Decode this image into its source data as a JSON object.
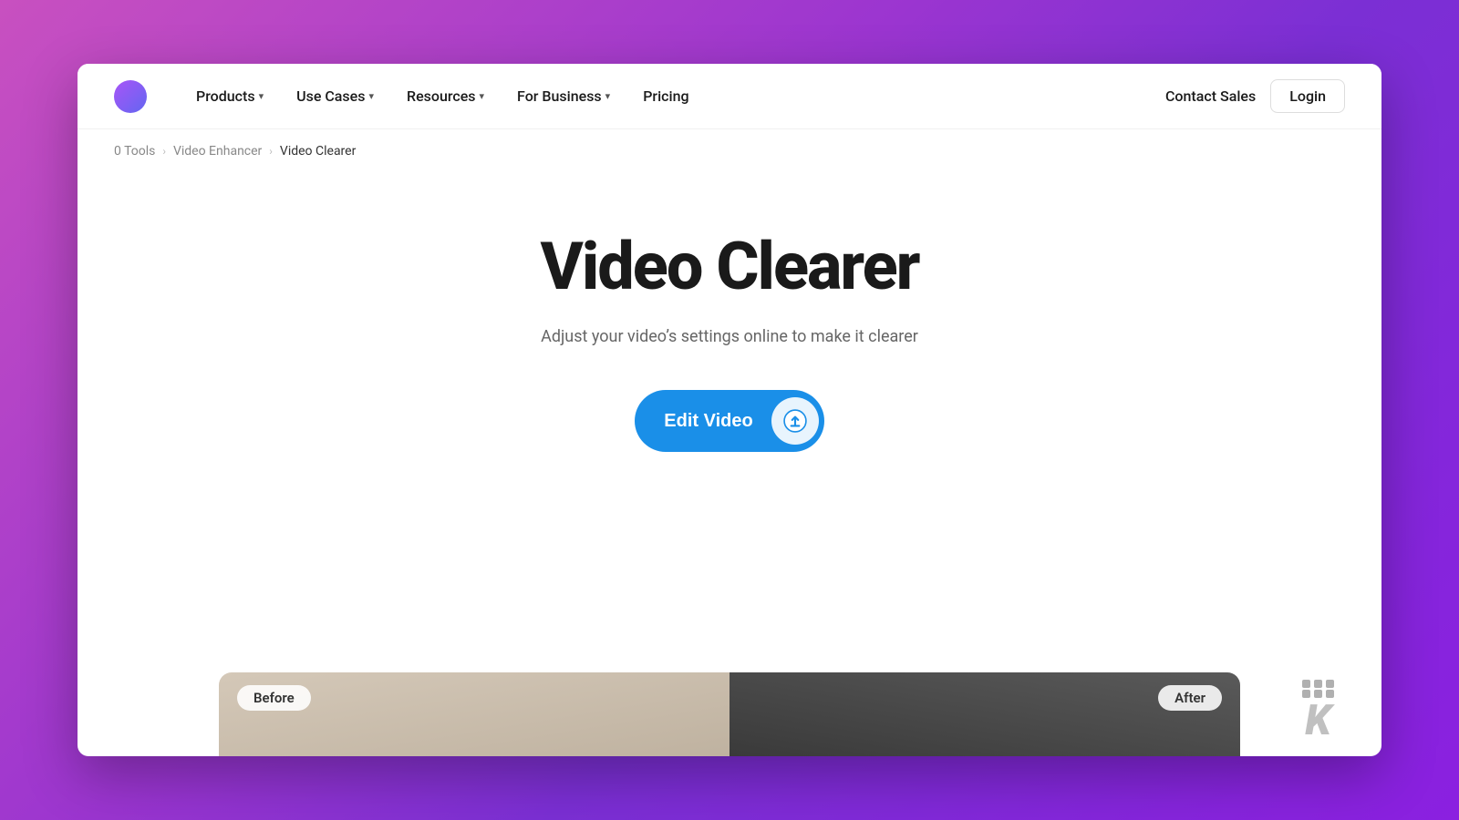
{
  "page": {
    "title": "Video Clearer"
  },
  "background": {
    "gradient": "linear-gradient(135deg, #c850c0 0%, #9b35d0 40%, #7b2fd4 60%, #8b20e0 100%)"
  },
  "navbar": {
    "logo_alt": "Kapwing logo circle",
    "items": [
      {
        "label": "Products",
        "has_dropdown": true
      },
      {
        "label": "Use Cases",
        "has_dropdown": true
      },
      {
        "label": "Resources",
        "has_dropdown": true
      },
      {
        "label": "For Business",
        "has_dropdown": true
      },
      {
        "label": "Pricing",
        "has_dropdown": false
      }
    ],
    "right_items": [
      {
        "label": "Contact Sales"
      },
      {
        "label": "Login"
      }
    ]
  },
  "breadcrumb": {
    "items": [
      {
        "label": "0 Tools",
        "active": false
      },
      {
        "label": "Video Enhancer",
        "active": false
      },
      {
        "label": "Video Clearer",
        "active": true
      }
    ]
  },
  "hero": {
    "title": "Video Clearer",
    "subtitle": "Adjust your video’s settings online to make it clearer",
    "cta_label": "Edit Video",
    "upload_icon": "upload-icon"
  },
  "before_after": {
    "before_label": "Before",
    "after_label": "After"
  },
  "watermark": {
    "letter": "K"
  }
}
